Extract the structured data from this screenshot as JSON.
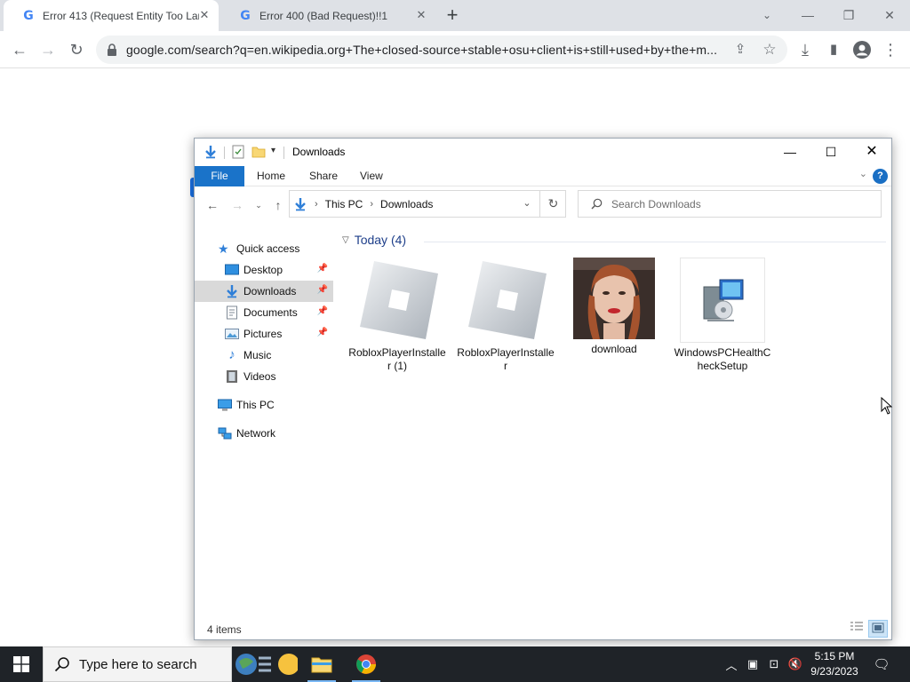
{
  "browser": {
    "tabs": [
      {
        "title": "Error 413 (Request Entity Too Lar",
        "active": true
      },
      {
        "title": "Error 400 (Bad Request)!!1",
        "active": false
      }
    ],
    "url": "google.com/search?q=en.wikipedia.org+The+closed-source+stable+osu+client+is+still+used+by+the+m..."
  },
  "explorer": {
    "title": "Downloads",
    "ribbon_tabs": {
      "file": "File",
      "home": "Home",
      "share": "Share",
      "view": "View"
    },
    "help": "?",
    "breadcrumb": [
      "This PC",
      "Downloads"
    ],
    "search_placeholder": "Search Downloads",
    "nav": {
      "quick_access": "Quick access",
      "desktop": "Desktop",
      "downloads": "Downloads",
      "documents": "Documents",
      "pictures": "Pictures",
      "music": "Music",
      "videos": "Videos",
      "this_pc": "This PC",
      "network": "Network"
    },
    "group_header": "Today (4)",
    "files": [
      {
        "name": "RobloxPlayerInstaller (1)"
      },
      {
        "name": "RobloxPlayerInstaller"
      },
      {
        "name": "download"
      },
      {
        "name": "WindowsPCHealthCheckSetup"
      }
    ],
    "status": "4 items"
  },
  "taskbar": {
    "search_text": "Type here to search",
    "time": "5:15 PM",
    "date": "9/23/2023"
  },
  "colors": {
    "chrome_tabbar": "#dee1e6",
    "ribbon_file": "#1a73c9",
    "selected_nav": "#d9d9d9",
    "taskbar": "#1f2328"
  }
}
